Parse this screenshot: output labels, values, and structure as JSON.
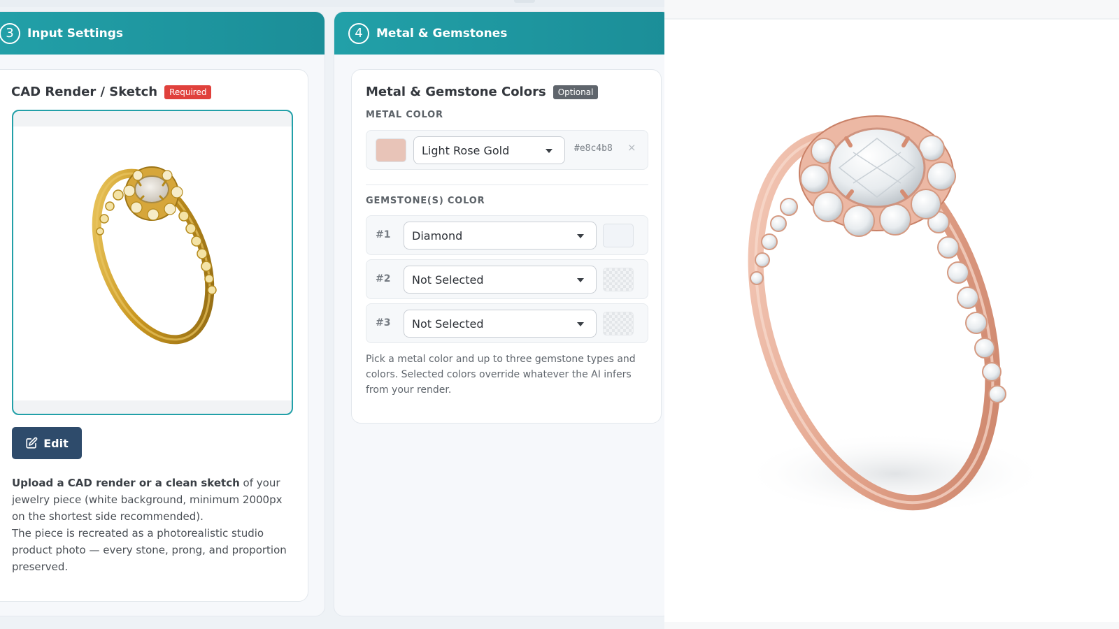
{
  "step3": {
    "number": "3",
    "title": "Input Settings",
    "card_title": "CAD Render / Sketch",
    "badge": "Required",
    "edit_label": "Edit",
    "desc_bold": "Upload a CAD render or a clean sketch",
    "desc_rest": " of your jewelry piece (white background, minimum 2000px on the shortest side recommended).",
    "desc_line2": "The piece is recreated as a photorealistic studio product photo — every stone, prong, and proportion preserved."
  },
  "step4": {
    "number": "4",
    "title": "Metal & Gemstones",
    "card_title": "Metal & Gemstone Colors",
    "badge": "Optional",
    "metal_label": "METAL COLOR",
    "metal": {
      "value": "Light Rose Gold",
      "hex": "#e8c4b8",
      "clear": "×"
    },
    "gem_label": "GEMSTONE(S) COLOR",
    "gems": [
      {
        "num": "#1",
        "value": "Diamond",
        "color": "#f1f4f8"
      },
      {
        "num": "#2",
        "value": "Not Selected",
        "color": null
      },
      {
        "num": "#3",
        "value": "Not Selected",
        "color": null
      }
    ],
    "hint": "Pick a metal color and up to three gemstone types and colors. Selected colors override whatever the AI infers from your render."
  },
  "colors": {
    "accent": "#1f9aa3",
    "edit_button": "#2e4b6b",
    "required": "#e0413c",
    "optional": "#5f656c",
    "input_metal": "#d4a24a",
    "output_metal": "#e8a98f"
  },
  "icons": {
    "edit": "edit-icon",
    "caret": "chevron-down-icon",
    "clear": "close-icon"
  }
}
